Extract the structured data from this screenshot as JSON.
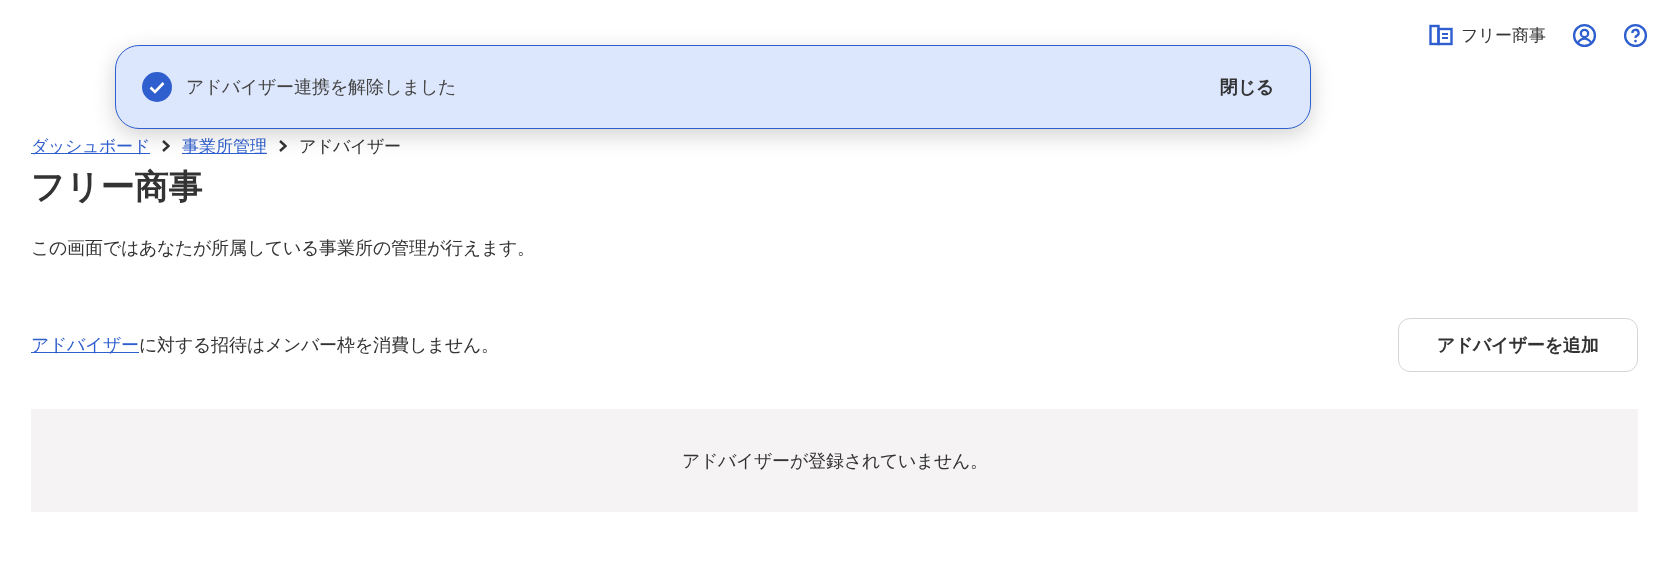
{
  "header": {
    "office_name": "フリー商事"
  },
  "toast": {
    "message": "アドバイザー連携を解除しました",
    "close_label": "閉じる"
  },
  "breadcrumbs": [
    {
      "label": "ダッシュボード",
      "link": true
    },
    {
      "label": "事業所管理",
      "link": true
    },
    {
      "label": "アドバイザー",
      "link": false
    }
  ],
  "title": "フリー商事",
  "description": "この画面ではあなたが所属している事業所の管理が行えます。",
  "notice": {
    "link": "アドバイザー",
    "text": "に対する招待はメンバー枠を消費しません。"
  },
  "add_button": "アドバイザーを追加",
  "empty_message": "アドバイザーが登録されていません。"
}
